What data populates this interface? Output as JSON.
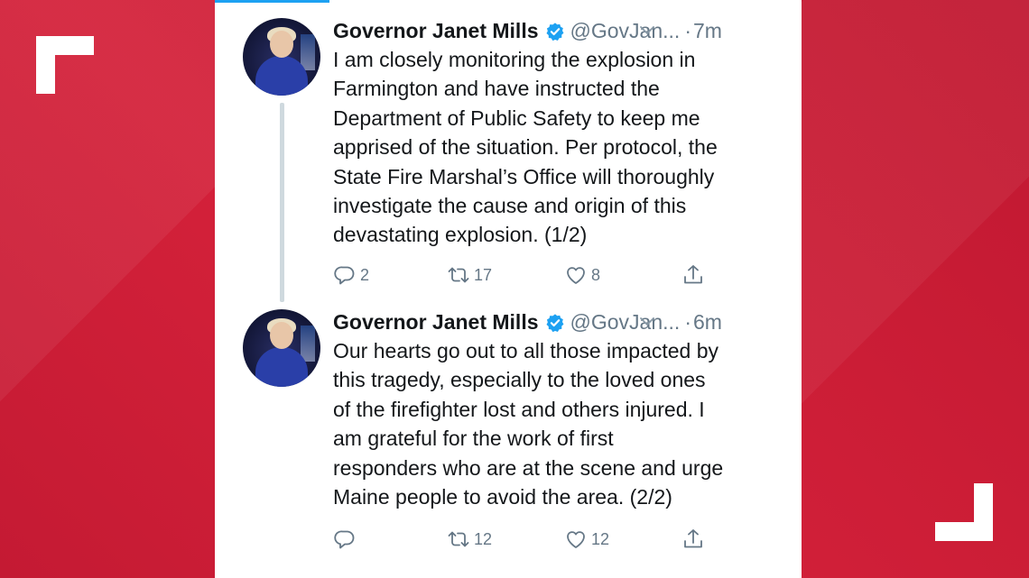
{
  "tweets": [
    {
      "name": "Governor Janet Mills",
      "handle": "@GovJan...",
      "separator": "·",
      "time": "7m",
      "text": "I am closely monitoring the explosion in\nFarmington and have instructed the\nDepartment of Public Safety to keep me\napprised of the situation. Per protocol, the\nState Fire Marshal’s Office will thoroughly\ninvestigate the cause and origin of this\ndevastating explosion. (1/2)",
      "replies": "2",
      "retweets": "17",
      "likes": "8"
    },
    {
      "name": "Governor Janet Mills",
      "handle": "@GovJan...",
      "separator": "·",
      "time": "6m",
      "text": "Our hearts go out to all those impacted by\nthis tragedy, especially to the loved ones\nof the firefighter lost and others injured. I\nam grateful for the work of first\nresponders who are at the scene and urge\nMaine people to avoid the area. (2/2)",
      "replies": "",
      "retweets": "12",
      "likes": "12"
    }
  ],
  "colors": {
    "background": "#c81d35",
    "card": "#ffffff",
    "accent": "#1da1f2",
    "text": "#14171a",
    "muted": "#657786"
  },
  "icons": [
    "verified-badge-icon",
    "chevron-down-icon",
    "reply-icon",
    "retweet-icon",
    "like-icon",
    "share-icon"
  ]
}
